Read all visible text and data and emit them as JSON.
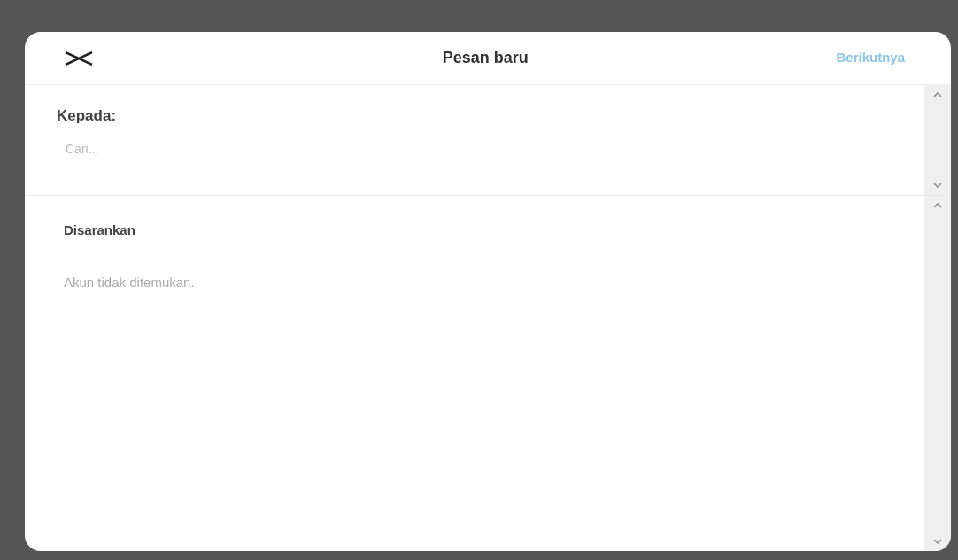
{
  "dialog": {
    "title": "Pesan baru",
    "next_button": "Berikutnya"
  },
  "recipient": {
    "label": "Kepada:",
    "placeholder": "Cari..."
  },
  "suggested": {
    "heading": "Disarankan",
    "empty_message": "Akun tidak ditemukan."
  }
}
